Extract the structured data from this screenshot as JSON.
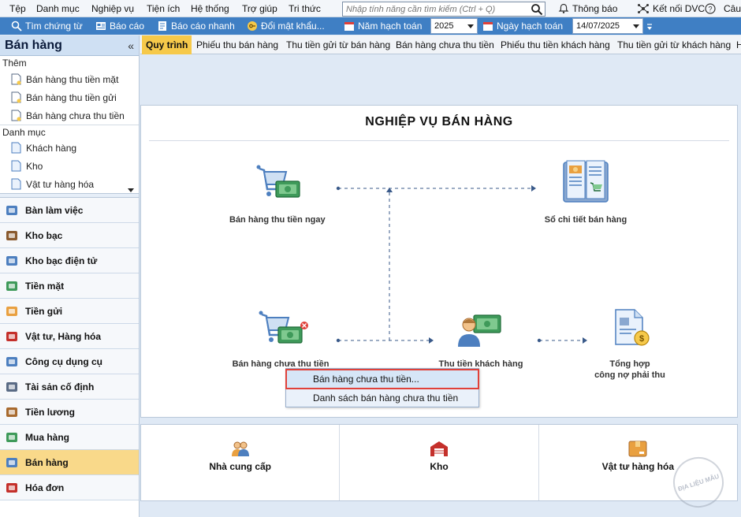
{
  "menubar": {
    "items": [
      "Tệp",
      "Danh mục",
      "Nghiệp vụ",
      "Tiện ích",
      "Hệ thống",
      "Trợ giúp",
      "Tri thức"
    ],
    "search_placeholder": "Nhập tính năng cần tìm kiếm (Ctrl + Q)",
    "notifications": "Thông báo",
    "connect": "Kết nối DVC",
    "help": "Câu"
  },
  "toolbar": {
    "find_voucher": "Tìm chứng từ",
    "report": "Báo cáo",
    "quick_report": "Báo cáo nhanh",
    "change_password": "Đổi mật khẩu...",
    "fiscal_year_label": "Năm hạch toán",
    "fiscal_year_value": "2025",
    "posting_date_label": "Ngày hạch toán",
    "posting_date_value": "14/07/2025"
  },
  "sidebar": {
    "title": "Bán hàng",
    "collapse": "«",
    "add_section": "Thêm",
    "add_items": [
      "Bán hàng thu tiền mặt",
      "Bán hàng thu tiền gửi",
      "Bán hàng chưa thu tiền"
    ],
    "catalog_section": "Danh mục",
    "catalog_items": [
      "Khách hàng",
      "Kho",
      "Vật tư hàng hóa"
    ],
    "modules": [
      "Bàn làm việc",
      "Kho bạc",
      "Kho bạc điện tử",
      "Tiền mặt",
      "Tiền gửi",
      "Vật tư, Hàng hóa",
      "Công cụ dụng cụ",
      "Tài sản cố định",
      "Tiền lương",
      "Mua hàng",
      "Bán hàng",
      "Hóa đơn"
    ],
    "active_module": "Bán hàng"
  },
  "tabs": [
    "Quy trình",
    "Phiếu thu bán hàng",
    "Thu tiền gửi từ bán hàng",
    "Bán hàng chưa thu tiền",
    "Phiếu thu tiền khách hàng",
    "Thu tiền gửi từ khách hàng",
    "H"
  ],
  "flow": {
    "title": "NGHIỆP VỤ BÁN HÀNG",
    "nodes": {
      "cash_sale": "Bán hàng thu tiền ngay",
      "sales_ledger": "Sổ chi tiết bán hàng",
      "credit_sale": "Bán hàng chưa thu tiền",
      "collect": "Thu tiền khách hàng",
      "summary_line1": "Tổng hợp",
      "summary_line2": "công nợ phải thu"
    },
    "context_menu": [
      "Bán hàng chưa thu tiền...",
      "Danh sách bán hàng chưa thu tiền"
    ]
  },
  "bottom": [
    "Nhà cung cấp",
    "Kho",
    "Vật tư hàng hóa"
  ],
  "stamp": "ĐỊA LIỆU MẪU",
  "colors": {
    "toolbar": "#3f7fc4",
    "active_tab": "#f6c94a",
    "active_module": "#f9d98a",
    "highlight_border": "#e0413a"
  }
}
